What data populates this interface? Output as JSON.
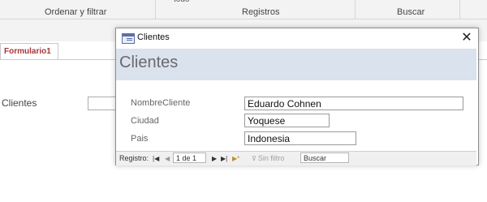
{
  "ribbon": {
    "residue_text": "todo",
    "groups": [
      "Ordenar y filtrar",
      "Registros",
      "Buscar"
    ]
  },
  "document": {
    "tab_label": "Formulario1",
    "background_field_label": "Clientes"
  },
  "dialog": {
    "window_title": "Clientes",
    "close_symbol": "✕",
    "header_title": "Clientes",
    "fields": [
      {
        "label": "NombreCliente",
        "value": "Eduardo Cohnen"
      },
      {
        "label": "Ciudad",
        "value": "Yoquese"
      },
      {
        "label": "Pais",
        "value": "Indonesia"
      }
    ],
    "navigation": {
      "label": "Registro:",
      "first": "|◀",
      "prev": "◀",
      "record_position": "1 de 1",
      "next": "▶",
      "last": "▶|",
      "new": "▶*",
      "filter_icon": "⊽",
      "filter_label": "Sin filtro",
      "search_label": "Buscar"
    }
  },
  "colors": {
    "tab_text": "#a4373a",
    "header_band": "#dae2ee"
  }
}
